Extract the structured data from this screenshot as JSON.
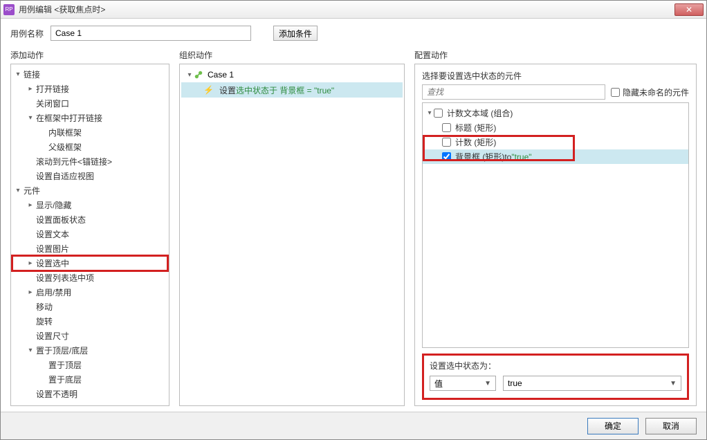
{
  "titlebar": {
    "title": "用例编辑 <获取焦点时>",
    "close": "✕"
  },
  "nameRow": {
    "label": "用例名称",
    "value": "Case 1",
    "addCondition": "添加条件"
  },
  "col": {
    "left": "添加动作",
    "mid": "组织动作",
    "right": "配置动作"
  },
  "actionTree": [
    {
      "label": "链接",
      "depth": 0,
      "tg": "▾"
    },
    {
      "label": "打开链接",
      "depth": 1,
      "tg": "▸"
    },
    {
      "label": "关闭窗口",
      "depth": 1,
      "tg": ""
    },
    {
      "label": "在框架中打开链接",
      "depth": 1,
      "tg": "▾"
    },
    {
      "label": "内联框架",
      "depth": 2,
      "tg": ""
    },
    {
      "label": "父级框架",
      "depth": 2,
      "tg": ""
    },
    {
      "label": "滚动到元件<锚链接>",
      "depth": 1,
      "tg": ""
    },
    {
      "label": "设置自适应视图",
      "depth": 1,
      "tg": ""
    },
    {
      "label": "元件",
      "depth": 0,
      "tg": "▾"
    },
    {
      "label": "显示/隐藏",
      "depth": 1,
      "tg": "▸"
    },
    {
      "label": "设置面板状态",
      "depth": 1,
      "tg": ""
    },
    {
      "label": "设置文本",
      "depth": 1,
      "tg": ""
    },
    {
      "label": "设置图片",
      "depth": 1,
      "tg": ""
    },
    {
      "label": "设置选中",
      "depth": 1,
      "tg": "▸",
      "highlight": true
    },
    {
      "label": "设置列表选中项",
      "depth": 1,
      "tg": ""
    },
    {
      "label": "启用/禁用",
      "depth": 1,
      "tg": "▸"
    },
    {
      "label": "移动",
      "depth": 1,
      "tg": ""
    },
    {
      "label": "旋转",
      "depth": 1,
      "tg": ""
    },
    {
      "label": "设置尺寸",
      "depth": 1,
      "tg": ""
    },
    {
      "label": "置于顶层/底层",
      "depth": 1,
      "tg": "▾"
    },
    {
      "label": "置于顶层",
      "depth": 2,
      "tg": ""
    },
    {
      "label": "置于底层",
      "depth": 2,
      "tg": ""
    },
    {
      "label": "设置不透明",
      "depth": 1,
      "tg": ""
    }
  ],
  "mid": {
    "caseName": "Case 1",
    "actionPrefix": "设置 ",
    "actionGreen": "选中状态于 背景框 = \"true\""
  },
  "config": {
    "title": "选择要设置选中状态的元件",
    "searchPlaceholder": "查找",
    "hideUnnamed": "隐藏未命名的元件",
    "widgets": {
      "group": "计数文本域 (组合)",
      "item1": "标题 (矩形)",
      "item2": "计数 (矩形)",
      "item3": "背景框 (矩形)",
      "item3to": " to ",
      "item3val": "\"true\""
    },
    "setState": {
      "title": "设置选中状态为：",
      "left": "值",
      "right": "true"
    }
  },
  "footer": {
    "ok": "确定",
    "cancel": "取消"
  }
}
